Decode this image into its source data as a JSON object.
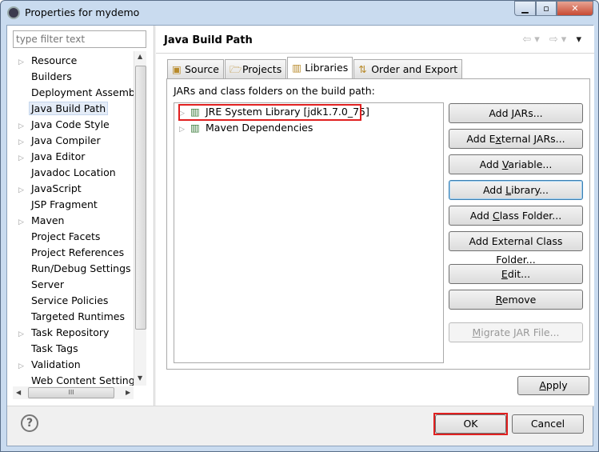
{
  "window": {
    "title": "Properties for mydemo",
    "minimize": "▁",
    "maximize": "▫",
    "close": "✕"
  },
  "filter": {
    "placeholder": "type filter text"
  },
  "tree": [
    {
      "label": "Resource",
      "expandable": true
    },
    {
      "label": "Builders",
      "expandable": false
    },
    {
      "label": "Deployment Assembly",
      "expandable": false
    },
    {
      "label": "Java Build Path",
      "expandable": false,
      "selected": true
    },
    {
      "label": "Java Code Style",
      "expandable": true
    },
    {
      "label": "Java Compiler",
      "expandable": true
    },
    {
      "label": "Java Editor",
      "expandable": true
    },
    {
      "label": "Javadoc Location",
      "expandable": false
    },
    {
      "label": "JavaScript",
      "expandable": true
    },
    {
      "label": "JSP Fragment",
      "expandable": false
    },
    {
      "label": "Maven",
      "expandable": true
    },
    {
      "label": "Project Facets",
      "expandable": false
    },
    {
      "label": "Project References",
      "expandable": false
    },
    {
      "label": "Run/Debug Settings",
      "expandable": false
    },
    {
      "label": "Server",
      "expandable": false
    },
    {
      "label": "Service Policies",
      "expandable": false
    },
    {
      "label": "Targeted Runtimes",
      "expandable": false
    },
    {
      "label": "Task Repository",
      "expandable": true
    },
    {
      "label": "Task Tags",
      "expandable": false
    },
    {
      "label": "Validation",
      "expandable": true
    },
    {
      "label": "Web Content Settings",
      "expandable": false
    }
  ],
  "page": {
    "title": "Java Build Path"
  },
  "tabs": [
    {
      "label": "Source",
      "icon": "source-folder-icon"
    },
    {
      "label": "Projects",
      "icon": "folder-icon"
    },
    {
      "label": "Libraries",
      "icon": "library-icon",
      "active": true
    },
    {
      "label": "Order and Export",
      "icon": "order-icon"
    }
  ],
  "libraries": {
    "label": "JARs and class folders on the build path:",
    "items": [
      {
        "label": "JRE System Library [jdk1.7.0_75]",
        "highlighted": true
      },
      {
        "label": "Maven Dependencies"
      }
    ]
  },
  "buttons": [
    {
      "pre": "Add ",
      "u": "J",
      "post": "ARs...",
      "state": "normal"
    },
    {
      "pre": "Add E",
      "u": "x",
      "post": "ternal JARs...",
      "state": "normal"
    },
    {
      "pre": "Add ",
      "u": "V",
      "post": "ariable...",
      "state": "normal"
    },
    {
      "pre": "Add ",
      "u": "L",
      "post": "ibrary...",
      "state": "focused"
    },
    {
      "pre": "Add ",
      "u": "C",
      "post": "lass Folder...",
      "state": "normal"
    },
    {
      "pre": "Add External Class Fol",
      "u": "d",
      "post": "er...",
      "state": "normal"
    },
    {
      "pre": "",
      "u": "E",
      "post": "dit...",
      "state": "normal"
    },
    {
      "pre": "",
      "u": "R",
      "post": "emove",
      "state": "normal"
    },
    {
      "pre": "",
      "u": "M",
      "post": "igrate JAR File...",
      "state": "disabled"
    }
  ],
  "apply": {
    "u": "A",
    "post": "pply"
  },
  "footer": {
    "help": "?",
    "ok": "OK",
    "cancel": "Cancel"
  },
  "colors": {
    "highlight": "#e02020",
    "selection": "#e4ecf7"
  }
}
